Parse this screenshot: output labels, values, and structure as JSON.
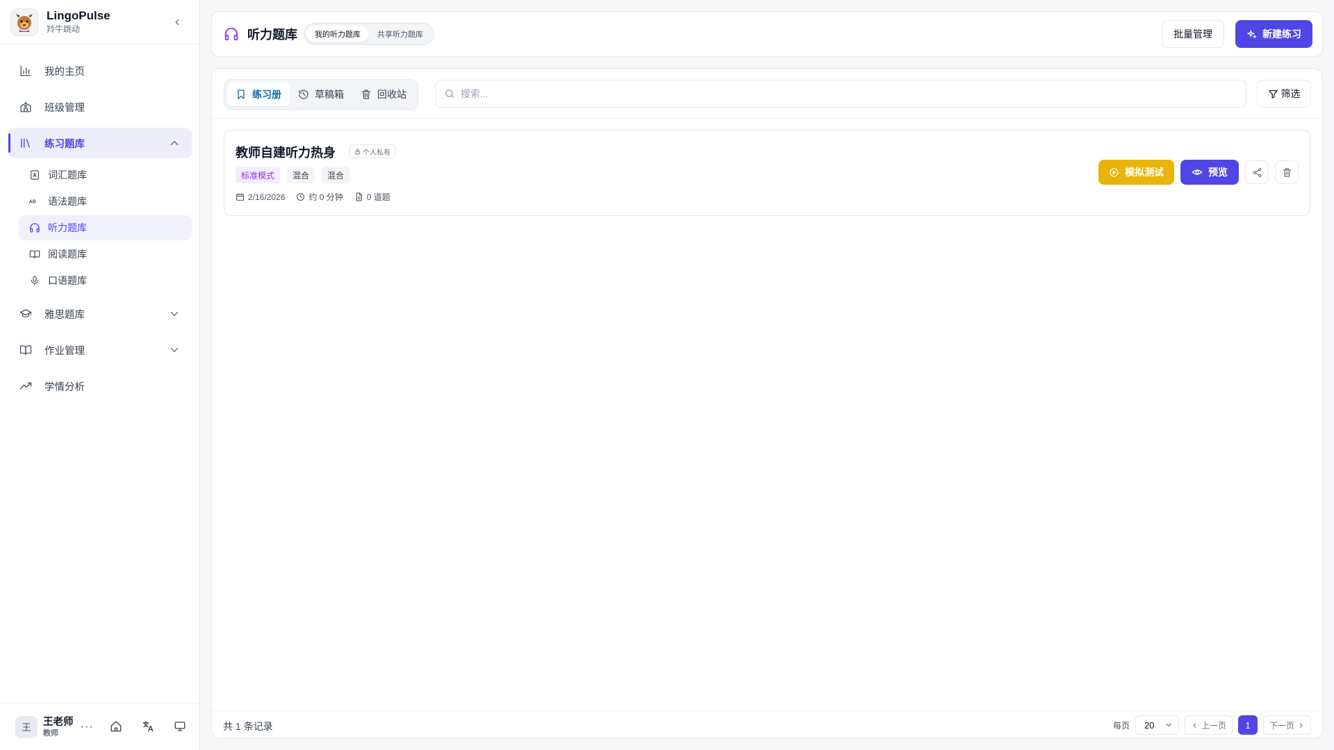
{
  "brand": {
    "name": "LingoPulse",
    "subtitle": "羚牛跳动"
  },
  "sidebar": {
    "items": [
      {
        "label": "我的主页",
        "icon": "bar-chart-icon"
      },
      {
        "label": "班级管理",
        "icon": "school-icon"
      },
      {
        "label": "练习题库",
        "icon": "library-icon",
        "active": true,
        "expanded": true
      },
      {
        "label": "雅思题库",
        "icon": "graduation-cap-icon"
      },
      {
        "label": "作业管理",
        "icon": "book-open-icon"
      },
      {
        "label": "学情分析",
        "icon": "trending-up-icon"
      }
    ],
    "subitems": [
      {
        "label": "词汇题库",
        "icon": "letter-a-icon"
      },
      {
        "label": "语法题库",
        "icon": "ab-icon"
      },
      {
        "label": "听力题库",
        "icon": "headphones-icon",
        "active": true
      },
      {
        "label": "阅读题库",
        "icon": "book-icon"
      },
      {
        "label": "口语题库",
        "icon": "microphone-icon"
      }
    ]
  },
  "user": {
    "avatar_initial": "王",
    "name": "王老师",
    "role": "教师",
    "more": "···"
  },
  "header": {
    "title": "听力题库",
    "segments": [
      "我的听力题库",
      "共享听力题库"
    ],
    "active_segment": 0,
    "batch_label": "批量管理",
    "new_label": "新建练习"
  },
  "toolbar": {
    "tabs": [
      "练习册",
      "草稿箱",
      "回收站"
    ],
    "active_tab": 0,
    "search_placeholder": "搜索...",
    "filter_label": "筛选"
  },
  "exercise": {
    "title": "教师自建听力热身",
    "visibility": "个人私有",
    "tags": [
      "标准模式",
      "混合",
      "混合"
    ],
    "date": "2/16/2026",
    "duration": "约 0 分钟",
    "questions": "0 道题",
    "mock_test_label": "模拟测试",
    "preview_label": "预览"
  },
  "footer": {
    "total": "共 1 条记录",
    "per_page_label": "每页",
    "per_page_value": "20",
    "prev_label": "上一页",
    "current_page": "1",
    "next_label": "下一页"
  },
  "colors": {
    "accent": "#4f46e5",
    "warning": "#eab308",
    "tab_active": "#0e6ea8",
    "mode_tag": "#9333ea"
  }
}
